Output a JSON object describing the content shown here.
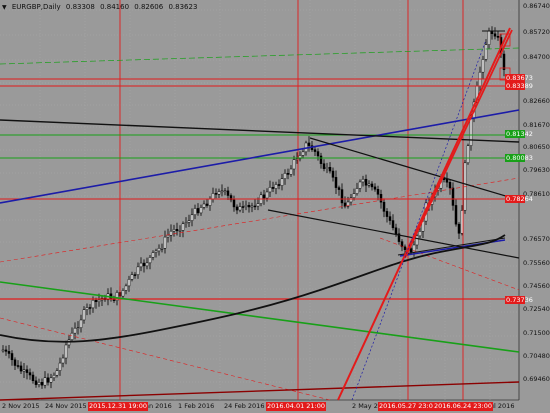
{
  "header": {
    "symbol": "EURGBP,Daily",
    "ohlc": [
      "0.83308",
      "0.84160",
      "0.82606",
      "0.83623"
    ]
  },
  "price_scale": [
    "0.86740",
    "0.85720",
    "0.84700",
    "0.83673",
    "0.83389",
    "0.82660",
    "0.81670",
    "0.81342",
    "0.80650",
    "0.80083",
    "0.79630",
    "0.78610",
    "0.78264",
    "0.76570",
    "0.75560",
    "0.74560",
    "0.73736",
    "0.72540",
    "0.71500",
    "0.70480",
    "0.69460"
  ],
  "highlight_tags": [
    {
      "text": "0.83673",
      "color": "#e31b1b"
    },
    {
      "text": "0.83389",
      "color": "#e31b1b"
    },
    {
      "text": "0.81342",
      "color": "#18a018"
    },
    {
      "text": "0.80083",
      "color": "#18a018"
    },
    {
      "text": "0.78264",
      "color": "#e31b1b"
    },
    {
      "text": "0.73736",
      "color": "#e31b1b"
    }
  ],
  "time_scale": [
    "2 Nov 2015",
    "24 Nov 2015",
    "an 2016",
    "1 Feb 2016",
    "24 Feb 2016",
    "2 May 2",
    "Jul 2016"
  ],
  "time_tags": [
    "2015.12.31 19:00",
    "2016.04.01 21:00",
    "2016.05.27 23:00",
    "2016.06.24 23:00"
  ],
  "colors": {
    "background": "#9a9a9a",
    "red_line": "#e31b1b",
    "green_line": "#18a018",
    "blue_line": "#1c1ca8",
    "black_line": "#111111",
    "dark_red_line": "#8b0000",
    "grid": "#a8a8a8"
  }
}
